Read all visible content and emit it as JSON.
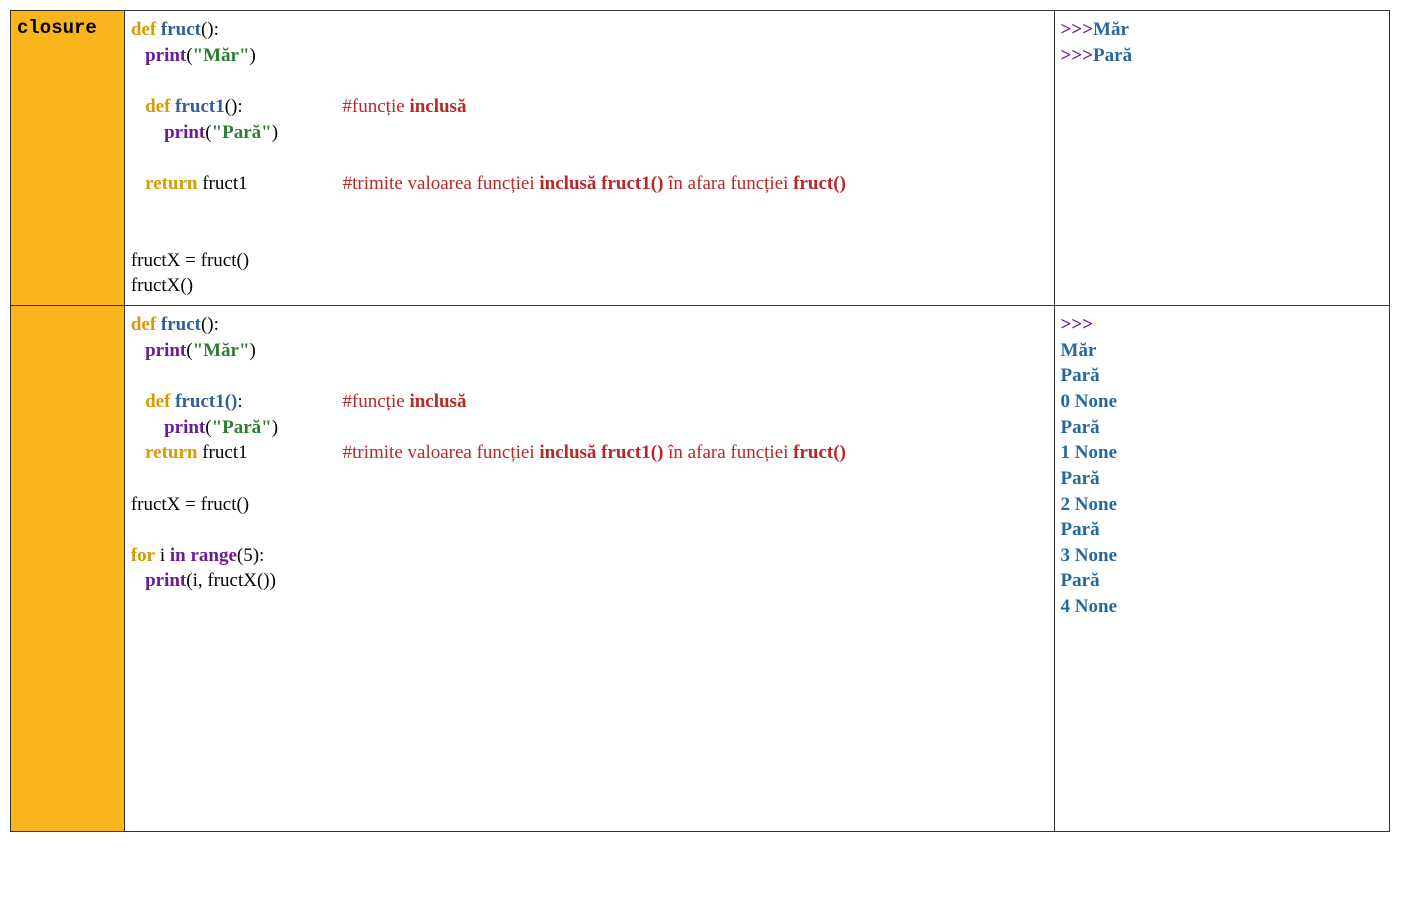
{
  "rows": [
    {
      "label": "closure",
      "code": {
        "def": "def",
        "fruct": "fruct",
        "parens": "():",
        "print": "print",
        "open": "(",
        "close": ")",
        "mar": "\"Măr\"",
        "fruct1": "fruct1",
        "comment1_pre": "#funcție ",
        "comment1_b": "inclusă",
        "para": "\"Pară\"",
        "return": "return",
        "ret_target": " fruct1",
        "comment2_pre": "#trimite valoarea funcției ",
        "comment2_b1": "inclusă fruct1()",
        "comment2_mid": " în afara funcției ",
        "comment2_b2": "fruct()",
        "assign": "fructX = fruct()",
        "call": "fructX()"
      },
      "out": {
        "p1": ">>>",
        "o1": "Măr",
        "p2": ">>>",
        "o2": "Pară"
      }
    },
    {
      "label": "",
      "code": {
        "def": "def",
        "fruct": "fruct",
        "parens": "():",
        "print": "print",
        "open": "(",
        "close": ")",
        "mar": "\"Măr\"",
        "fruct1": "fruct1",
        "parens1": "()",
        "colon": ":",
        "comment1_pre": "#funcție ",
        "comment1_b": "inclusă",
        "para": "\"Pară\"",
        "return": "return",
        "ret_target": " fruct1",
        "comment2_pre": "#trimite valoarea funcției ",
        "comment2_b1": "inclusă fruct1()",
        "comment2_mid": " în afara funcției ",
        "comment2_b2": "fruct()",
        "assign": "fructX = fruct()",
        "for": "for",
        "i": " i ",
        "in": "in",
        "range": "range",
        "five": "5",
        "loop_close": "):",
        "printargs": "(i, fructX())"
      },
      "out": {
        "p1": ">>>",
        "lines": [
          "Măr",
          "Pară",
          "0 None",
          "Pară",
          "1 None",
          "Pară",
          "2 None",
          "Pară",
          "3 None",
          "Pară",
          "4 None"
        ]
      }
    }
  ]
}
